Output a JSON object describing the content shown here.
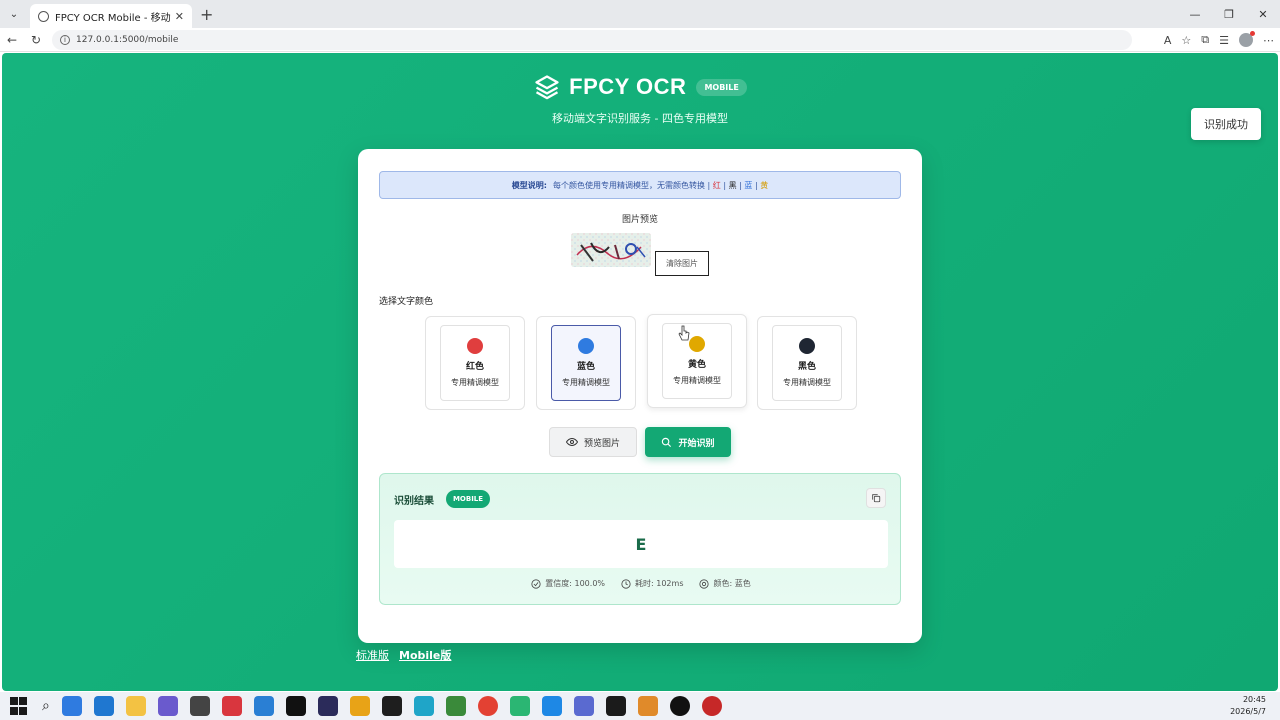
{
  "browser": {
    "tab_title": "FPCY OCR Mobile - 移动端识别",
    "url": "127.0.0.1:5000/mobile"
  },
  "header": {
    "brand": "FPCY OCR",
    "badge": "MOBILE",
    "subtitle": "移动端文字识别服务 - 四色专用模型"
  },
  "toast": {
    "text": "识别成功"
  },
  "note": {
    "label": "模型说明:",
    "text": "每个颜色使用专用精调模型，无需颜色转换 |",
    "red": "红",
    "sep1": "|",
    "black": "黑",
    "sep2": "|",
    "blue": "蓝",
    "sep3": "|",
    "yellow": "黄"
  },
  "preview": {
    "title": "图片预览",
    "clear_label": "清除图片"
  },
  "colors": {
    "title": "选择文字颜色",
    "items": [
      {
        "name": "红色",
        "desc": "专用精调模型",
        "color": "#e03e3e",
        "selected": false
      },
      {
        "name": "蓝色",
        "desc": "专用精调模型",
        "color": "#2f7be0",
        "selected": true
      },
      {
        "name": "黄色",
        "desc": "专用精调模型",
        "color": "#e0a800",
        "selected": false
      },
      {
        "name": "黑色",
        "desc": "专用精调模型",
        "color": "#1f2633",
        "selected": false
      }
    ]
  },
  "actions": {
    "preview_label": "预览图片",
    "start_label": "开始识别"
  },
  "result": {
    "title": "识别结果",
    "badge": "MOBILE",
    "text": "E",
    "confidence": "置信度: 100.0%",
    "time": "耗时: 102ms",
    "color": "颜色: 蓝色"
  },
  "footer": {
    "standard": "标准版",
    "mobile": "Mobile版"
  },
  "taskbar": {
    "time": "20:45",
    "date": "2026/5/7"
  },
  "accent": "#13a874"
}
